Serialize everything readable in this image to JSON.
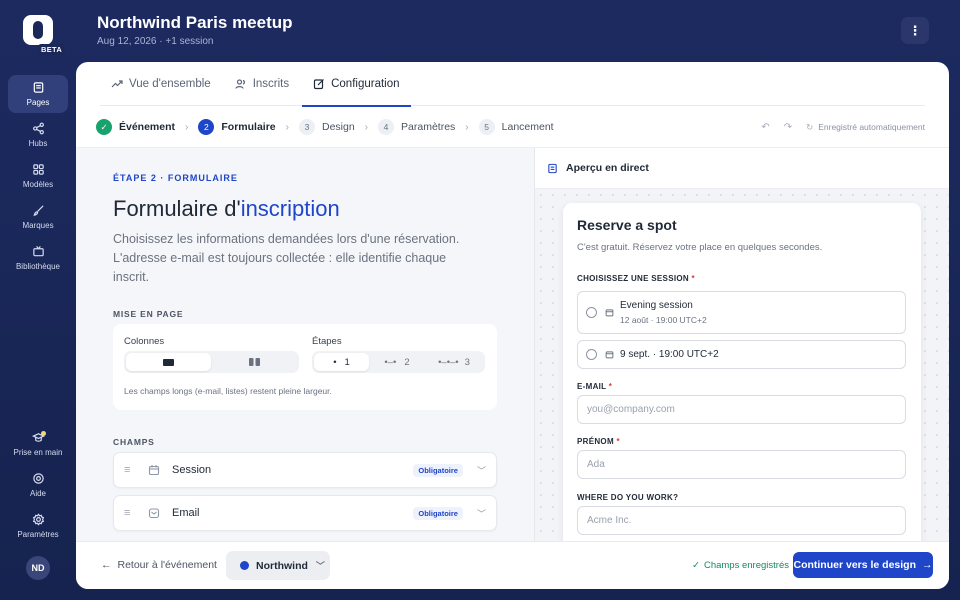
{
  "sidebar": {
    "badge": "BETA",
    "items": [
      {
        "label": "Pages",
        "icon": "pages-icon"
      },
      {
        "label": "Hubs",
        "icon": "share-icon"
      },
      {
        "label": "Modèles",
        "icon": "grid-icon"
      },
      {
        "label": "Marques",
        "icon": "brush-icon"
      },
      {
        "label": "Bibliothèque",
        "icon": "tv-icon"
      }
    ],
    "bottom_items": [
      {
        "label": "Prise en main",
        "icon": "graduation-cap-icon"
      },
      {
        "label": "Aide",
        "icon": "help-icon"
      },
      {
        "label": "Paramètres",
        "icon": "gear-icon"
      }
    ],
    "avatar_initials": "ND"
  },
  "header": {
    "title": "Northwind Paris meetup",
    "subtitle": "Aug 12, 2026 · +1 session",
    "menu_icon": "⋮"
  },
  "tabs": [
    {
      "label": "Vue d'ensemble",
      "icon": "trend-icon"
    },
    {
      "label": "Inscrits",
      "icon": "users-icon"
    },
    {
      "label": "Configuration",
      "icon": "edit-icon",
      "active": true
    }
  ],
  "steps": [
    {
      "num": "✓",
      "label": "Événement",
      "state": "done"
    },
    {
      "num": "2",
      "label": "Formulaire",
      "state": "current"
    },
    {
      "num": "3",
      "label": "Design",
      "state": "todo"
    },
    {
      "num": "4",
      "label": "Paramètres",
      "state": "todo"
    },
    {
      "num": "5",
      "label": "Lancement",
      "state": "todo"
    }
  ],
  "autosave": "Enregistré automatiquement",
  "editor": {
    "eyebrow": "ÉTAPE 2 · FORMULAIRE",
    "title_plain": "Formulaire d'",
    "title_accent": "inscription",
    "lead": "Choisissez les informations demandées lors d'une réservation. L'adresse e-mail est toujours collectée : elle identifie chaque inscrit.",
    "layout_section": "MISE EN PAGE",
    "columns_label": "Colonnes",
    "steps_label": "Étapes",
    "step_options": [
      "1",
      "2",
      "3"
    ],
    "layout_note": "Les champs longs (e-mail, listes) restent pleine largeur.",
    "fields_section": "CHAMPS",
    "fields": [
      {
        "label": "Session",
        "badge": "Obligatoire"
      },
      {
        "label": "Email",
        "badge": "Obligatoire"
      }
    ]
  },
  "preview": {
    "header": "Aperçu en direct",
    "title": "Reserve a spot",
    "subtitle": "C'est gratuit. Réservez votre place en quelques secondes.",
    "session_label": "CHOISISSEZ UNE SESSION",
    "sessions": [
      {
        "title": "Evening session",
        "sub": "12 août · 19:00 UTC+2"
      },
      {
        "title": "9 sept. · 19:00 UTC+2",
        "sub": ""
      }
    ],
    "email_label": "E-MAIL",
    "email_placeholder": "you@company.com",
    "first_name_label": "PRÉNOM",
    "first_name_placeholder": "Ada",
    "work_label": "WHERE DO YOU WORK?",
    "work_placeholder": "Acme Inc."
  },
  "footer": {
    "back": "Retour à l'événement",
    "brand": "Northwind",
    "saved": "Champs enregistrés",
    "cta": "Continuer vers le design"
  },
  "colors": {
    "accent": "#1f45c9",
    "sidebar": "#1c2a60",
    "success": "#18a26e"
  }
}
